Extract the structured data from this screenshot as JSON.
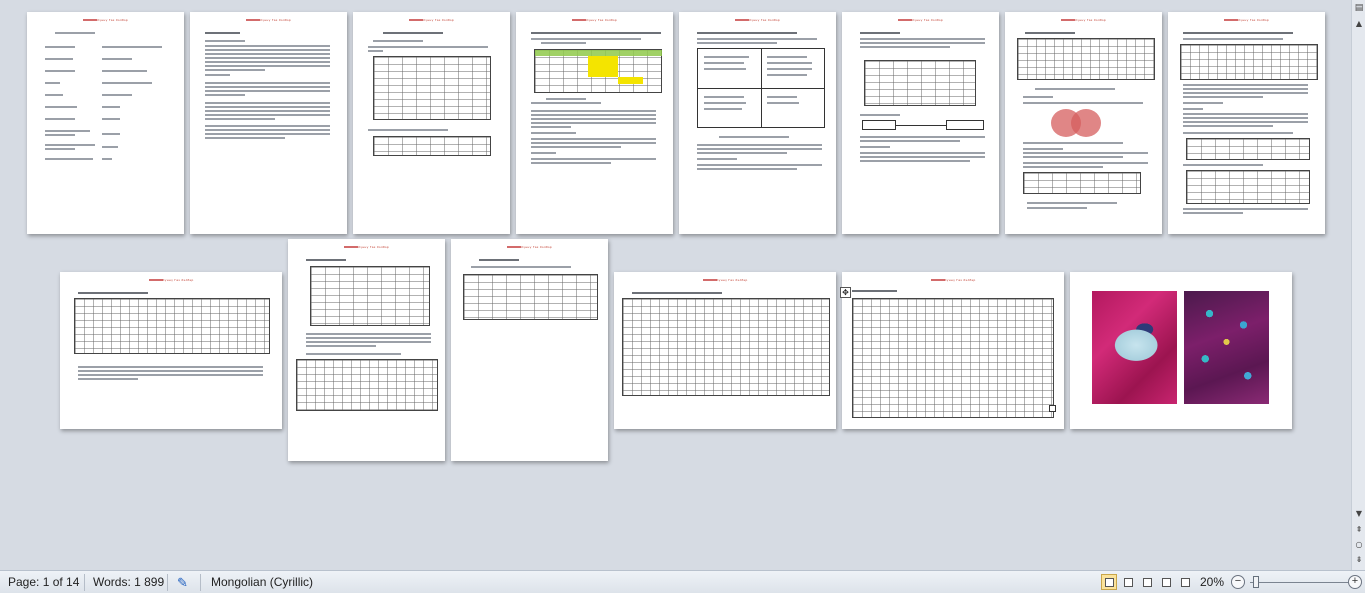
{
  "document": {
    "header_text": "Хүннү Газ Хэлбэр"
  },
  "statusbar": {
    "page_info": "Page: 1 of 14",
    "words": "Words: 1 899",
    "language": "Mongolian (Cyrillic)",
    "zoom": "20%",
    "zoom_out": "−",
    "zoom_in": "+"
  },
  "icons": {
    "proofing": "proofing-icon",
    "view_print_layout": "print-layout-icon",
    "view_full_screen": "full-screen-reading-icon",
    "view_web": "web-layout-icon",
    "view_outline": "outline-icon",
    "view_draft": "draft-icon",
    "move_handle": "table-move-handle-icon",
    "scroll_up": "scroll-up-icon",
    "scroll_down": "scroll-down-icon",
    "prev_page": "previous-page-icon",
    "select_browse": "select-browse-object-icon",
    "next_page": "next-page-icon",
    "ruler_toggle": "ruler-toggle-icon"
  },
  "colors": {
    "workspace": "#d6dbe3",
    "header_red": "#c0392b",
    "highlight_yellow": "#f4e400",
    "highlight_green": "#8fc94a",
    "venn_red": "#d65d5d",
    "active_view": "#fbe39b"
  }
}
